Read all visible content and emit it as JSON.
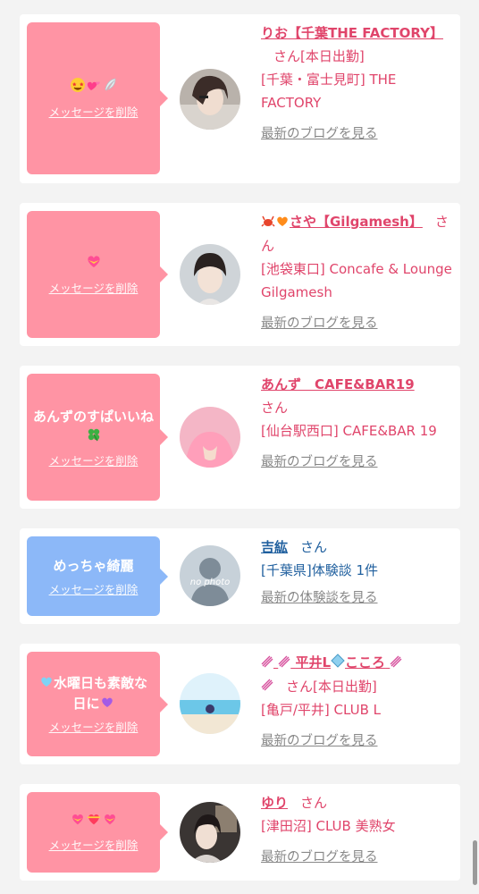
{
  "cards": [
    {
      "message": "",
      "delete_label": "メッセージを削除",
      "name": "りお【千葉THE FACTORY】",
      "honorific": "さん",
      "status": "[本日出勤]",
      "shop": "[千葉・富士見町] THE FACTORY",
      "link": "最新のブログを見る",
      "bubble_color": "#ff94a4",
      "icons": [
        "star-struck-face-icon",
        "two-hearts-icon",
        "feather-icon"
      ]
    },
    {
      "message": "",
      "delete_label": "メッセージを削除",
      "name": "さや【Gilgamesh】",
      "honorific": "さん",
      "shop": "[池袋東口] Concafe & Lounge Gilgamesh",
      "link": "最新のブログを見る",
      "bubble_color": "#ff94a4",
      "icons": [
        "heart-with-ribbon-icon"
      ],
      "name_icons": [
        "crab-icon",
        "orange-heart-icon"
      ]
    },
    {
      "message": "あんずのすぱいいね",
      "delete_label": "メッセージを削除",
      "name": "あんず　CAFE&BAR19",
      "honorific": "さん",
      "shop": "[仙台駅西口] CAFE&BAR 19",
      "link": "最新のブログを見る",
      "bubble_color": "#ff94a4",
      "icons": [
        "four-leaf-clover-icon"
      ]
    },
    {
      "message": "めっちゃ綺麗",
      "delete_label": "メッセージを削除",
      "name": "吉紘",
      "honorific": "さん",
      "shop": "[千葉県]体験談 1件",
      "link": "最新の体験談を見る",
      "bubble_color": "#8cb8f8",
      "avatar_text": "no photo"
    },
    {
      "message_line1": "水曜日も素敵な",
      "message_line2": "日に",
      "delete_label": "メッセージを削除",
      "name": "平井L",
      "name_part2": "こころ",
      "honorific": "さん",
      "status": "[本日出勤]",
      "shop": "[亀戸/平井] CLUB L",
      "link": "最新のブログを見る",
      "bubble_color": "#ff94a4",
      "icons": [
        "light-blue-heart-icon",
        "purple-heart-icon"
      ],
      "name_icons": [
        "dna-icon",
        "diamond-icon"
      ]
    },
    {
      "message": "",
      "delete_label": "メッセージを削除",
      "name": "ゆり",
      "honorific": "さん",
      "shop": "[津田沼] CLUB 美熟女",
      "link": "最新のブログを見る",
      "bubble_color": "#ff94a4",
      "icons": [
        "heart-with-ribbon-icon",
        "heart-on-fire-icon"
      ]
    }
  ]
}
